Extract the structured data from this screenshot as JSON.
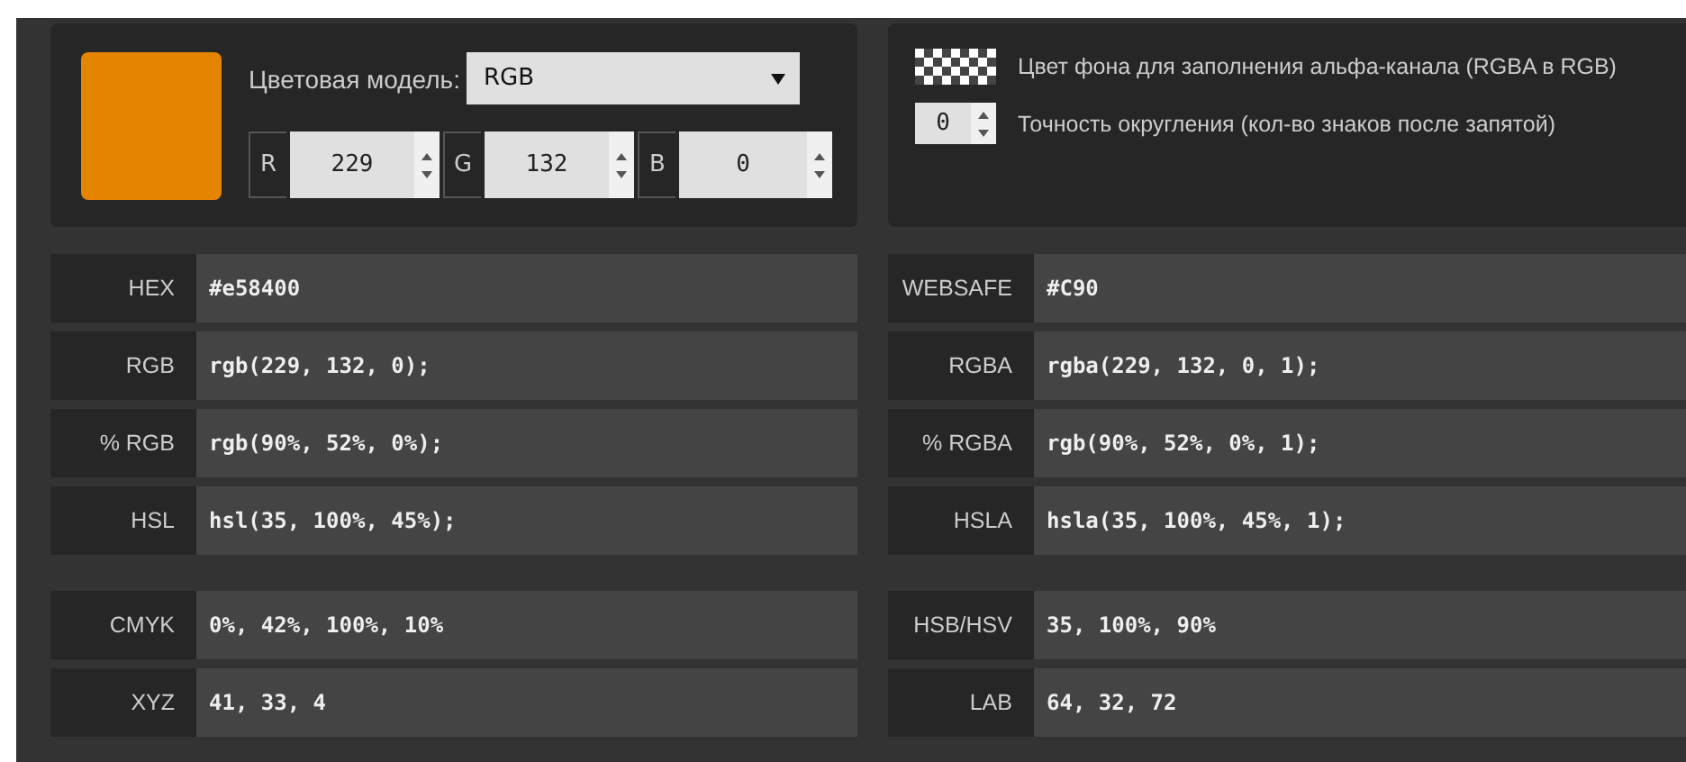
{
  "swatch": {
    "color": "#e58400"
  },
  "model": {
    "label": "Цветовая модель:",
    "value": "RGB"
  },
  "channels": [
    {
      "label": "R",
      "value": "229"
    },
    {
      "label": "G",
      "value": "132"
    },
    {
      "label": "B",
      "value": "0"
    }
  ],
  "options": {
    "alpha_background": "Цвет фона для заполнения альфа-канала (RGBA в RGB)",
    "precision": {
      "value": "0",
      "label": "Точность округления (кол-во знаков после запятой)"
    }
  },
  "groups": [
    {
      "left": [
        {
          "label": "HEX",
          "value": "#e58400"
        },
        {
          "label": "RGB",
          "value": "rgb(229, 132, 0);"
        },
        {
          "label": "% RGB",
          "value": "rgb(90%, 52%, 0%);"
        },
        {
          "label": "HSL",
          "value": "hsl(35, 100%, 45%);"
        }
      ],
      "right": [
        {
          "label": "WEBSAFE",
          "value": "#C90"
        },
        {
          "label": "RGBA",
          "value": "rgba(229, 132, 0, 1);"
        },
        {
          "label": "% RGBA",
          "value": "rgb(90%, 52%, 0%, 1);"
        },
        {
          "label": "HSLA",
          "value": "hsla(35, 100%, 45%, 1);"
        }
      ]
    },
    {
      "left": [
        {
          "label": "CMYK",
          "value": "0%, 42%, 100%, 10%"
        },
        {
          "label": "XYZ",
          "value": "41, 33, 4"
        }
      ],
      "right": [
        {
          "label": "HSB/HSV",
          "value": "35, 100%, 90%"
        },
        {
          "label": "LAB",
          "value": "64, 32, 72"
        }
      ]
    }
  ]
}
